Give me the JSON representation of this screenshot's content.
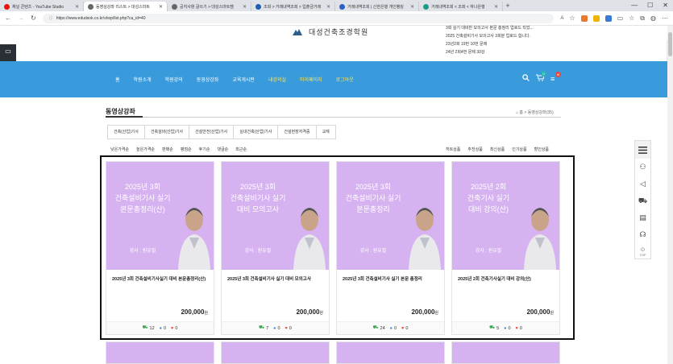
{
  "browser": {
    "tabs": [
      {
        "label": "채널 콘텐츠 - YouTube Studio",
        "fav": "#e11"
      },
      {
        "label": "동영상강좌 리스트 > 대성스마트",
        "fav": "#666",
        "active": true
      },
      {
        "label": "공지사항 글쓰기 > 대성스마트캠",
        "fav": "#666"
      },
      {
        "label": "조회 > 거래내역조회 > 입출금거래",
        "fav": "#1a5fb4"
      },
      {
        "label": "거래내역조회 | 신한은행 개인뱅킹",
        "fav": "#2a62c9"
      },
      {
        "label": "거래내역조회 < 조회 < 하나은행",
        "fav": "#1a9c8b"
      }
    ],
    "new_tab": "+",
    "url": "https://www.edudsok.co.kr/shop/list.php?ca_id=40"
  },
  "header": {
    "logo_text": "대성건축조경학원",
    "notices": [
      "3회 실기 대비반 모의고사 본문 총정리 업로드 되었...",
      "2025 건축설비기사 모의고사 3회분 업로드 합니다.",
      "23년2회 19번 10번 문제",
      "24년 2회4번 문제 30강"
    ]
  },
  "nav": {
    "items": [
      {
        "label": "홈"
      },
      {
        "label": "학원소개"
      },
      {
        "label": "학원강의"
      },
      {
        "label": "동영상강좌"
      },
      {
        "label": "교육게시판"
      },
      {
        "label": "내강의실",
        "yellow": true
      },
      {
        "label": "마이페이지",
        "yellow": true
      },
      {
        "label": "로그아웃",
        "yellow": true
      }
    ],
    "cart_count": "0",
    "menu_badge": "M"
  },
  "page": {
    "title": "동영상강좌",
    "breadcrumb": "홈 > 동영상강좌(35)",
    "categories": [
      "건축(산업)기사",
      "건축설비(산업)기사",
      "건설안전(산업)기사",
      "실내건축(산업)기사",
      "건설현장자격증",
      "교재"
    ],
    "sorts_left": [
      "낮은가격순",
      "높은가격순",
      "판매순",
      "평점순",
      "후기순",
      "댓글순",
      "최근순"
    ],
    "sorts_right": [
      "히트상품",
      "추천상품",
      "최신상품",
      "인기상품",
      "할인상품"
    ]
  },
  "products": [
    {
      "thumb_lines": [
        "2025년 3회",
        "건축설비기사 실기",
        "본문총정리(산)"
      ],
      "instructor": "강사 : 원유필",
      "name": "2025년 3회 건축설비기사실기 대비 본문총정리(산)",
      "price": "200,000",
      "unit": "원",
      "cart": "12",
      "comments": "0",
      "likes": "0"
    },
    {
      "thumb_lines": [
        "2025년 3회",
        "건축설비기사 실기",
        "대비 모의고사"
      ],
      "instructor": "강사 : 원유필",
      "name": "2025년 3회 건축설비기사 실기 대비 모의고사",
      "price": "200,000",
      "unit": "원",
      "cart": "7",
      "comments": "0",
      "likes": "0"
    },
    {
      "thumb_lines": [
        "2025년 3회",
        "건축설비기사 실기",
        "본문총정리"
      ],
      "instructor": "강사 : 원유필",
      "name": "2025년 3회 건축설비기사 실기 본문 총정리",
      "price": "200,000",
      "unit": "원",
      "cart": "24",
      "comments": "0",
      "likes": "0"
    },
    {
      "thumb_lines": [
        "2025년 2회",
        "건축기사 실기",
        "대비 강의(산)"
      ],
      "instructor": "강사 : 원유필",
      "name": "2025년 2회 건축기사실기 대비 강의(산)",
      "price": "200,000",
      "unit": "원",
      "cart": "5",
      "comments": "0",
      "likes": "0"
    }
  ],
  "quickbar": {
    "top_label": "TOP"
  }
}
